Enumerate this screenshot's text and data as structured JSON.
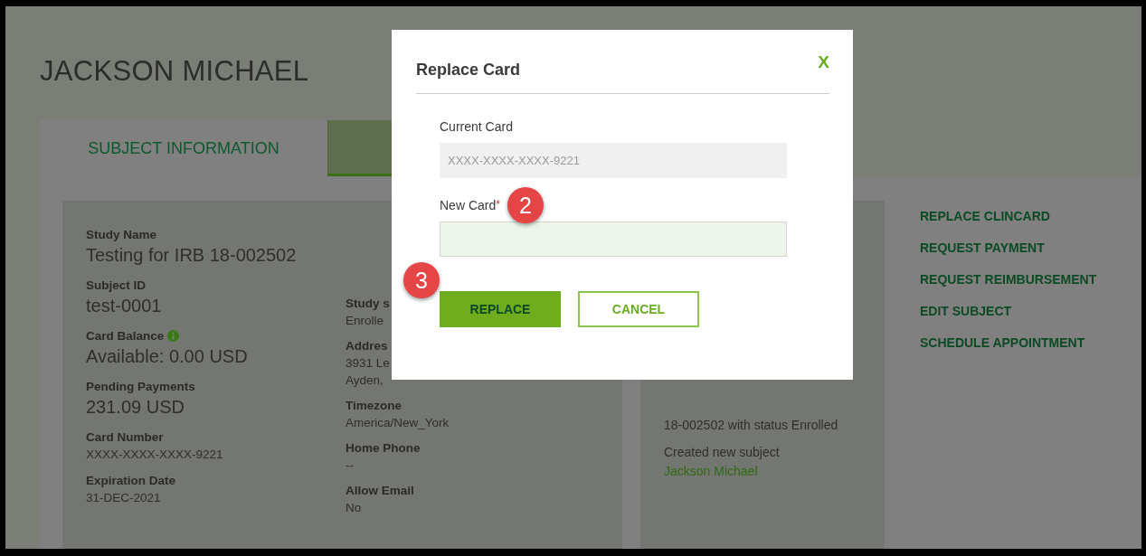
{
  "page_title": "JACKSON MICHAEL",
  "tabs": [
    {
      "label": "SUBJECT INFORMATION",
      "selected": false
    },
    {
      "selected": true
    }
  ],
  "details_left": [
    {
      "label": "Study Name",
      "value": "Testing for IRB 18-002502",
      "kind": "large"
    },
    {
      "label": "Subject ID",
      "value": "test-0001",
      "kind": "large"
    },
    {
      "label": "Card Balance",
      "value": "Available: 0.00 USD",
      "kind": "large",
      "info": true
    },
    {
      "label": "Pending Payments",
      "value": "231.09 USD",
      "kind": "large"
    },
    {
      "label": "Card Number",
      "value": "XXXX-XXXX-XXXX-9221",
      "kind": "small"
    },
    {
      "label": "Expiration Date",
      "value": "31-DEC-2021",
      "kind": "small"
    }
  ],
  "details_right": [
    {
      "label": "Study s",
      "value": "Enrolle"
    },
    {
      "label": "Addres",
      "value": "3931 Le",
      "value_2": "Ayden,"
    },
    {
      "label": "Timezone",
      "value": "America/New_York"
    },
    {
      "label": "Home Phone",
      "value": "--"
    },
    {
      "label": "Allow Email",
      "value": "No"
    }
  ],
  "activity": {
    "text": "18-002502 with status Enrolled",
    "text_2": "Created new subject ",
    "link": "Jackson Michael"
  },
  "actions": [
    "REPLACE CLINCARD",
    "REQUEST PAYMENT",
    "REQUEST REIMBURSEMENT",
    "EDIT SUBJECT",
    "SCHEDULE APPOINTMENT"
  ],
  "dialog": {
    "title": "Replace Card",
    "close": "X",
    "fields": [
      {
        "label": "Current Card",
        "placeholder": "XXXX-XXXX-XXXX-9221",
        "disabled": true
      },
      {
        "label": "New Card",
        "required_mark": "*",
        "disabled": false
      }
    ],
    "buttons": [
      {
        "label": "REPLACE",
        "kind": "primary"
      },
      {
        "label": "CANCEL",
        "kind": "secondary"
      }
    ]
  },
  "markers": [
    "2",
    "3"
  ]
}
